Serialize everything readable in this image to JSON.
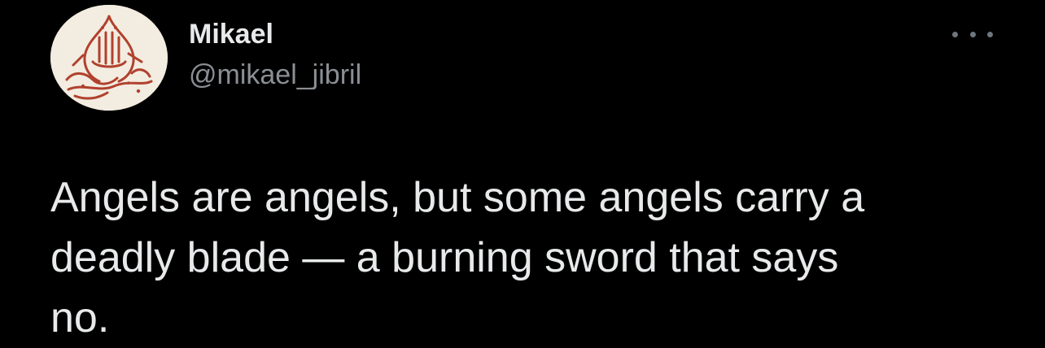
{
  "author": {
    "display_name": "Mikael",
    "handle": "@mikael_jibril",
    "avatar_icon": "arabic-calligraphy-avatar"
  },
  "tweet": {
    "text": "Angels are angels, but some angels carry a\ndeadly blade — a burning sword that says\nno."
  },
  "actions": {
    "more_icon": "more-horizontal-icon"
  },
  "colors": {
    "background": "#000000",
    "text_primary": "#e7e9ea",
    "text_secondary": "#8b8f94",
    "avatar_background": "#f3ece0",
    "calligraphy": "#b0412e"
  }
}
